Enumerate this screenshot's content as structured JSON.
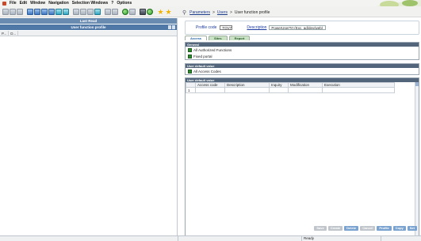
{
  "menu": [
    "File",
    "Edit",
    "Window",
    "Navigation",
    "Selection Windows",
    "?",
    "Options"
  ],
  "breadcrumb": {
    "part1": "Parameters",
    "part2": "Users",
    "current": "User function profile"
  },
  "left_panel": {
    "bar_top": "Last Read",
    "bar_title": "User function profile",
    "columns": [
      "P...",
      "D..."
    ]
  },
  "profile": {
    "code_label": "Profile code",
    "code_value": "TOV7",
    "desc_label": "Description",
    "desc_value": "PowerUserTrt (Exc. ad/dev/web)"
  },
  "tabs": [
    "Access",
    "Sites",
    "Report"
  ],
  "general": {
    "title": "General",
    "options": [
      "All Authorized Functions",
      "Fixed portal"
    ]
  },
  "default_value_1": {
    "title": "User default value",
    "options": [
      "All Access Codes"
    ]
  },
  "default_value_2": {
    "title": "User default value",
    "columns": [
      "Access code",
      "Description",
      "Inquiry",
      "Modification",
      "Execution"
    ],
    "rows": [
      [
        "1",
        "",
        "",
        "",
        "",
        ""
      ]
    ]
  },
  "buttons": [
    "Save",
    "Create",
    "Delete",
    "Cancel",
    "Profile",
    "Copy",
    "Set"
  ],
  "button_states": [
    false,
    false,
    true,
    false,
    true,
    true,
    true
  ],
  "status": {
    "text": "Ready"
  },
  "colors": {
    "accent": "#52657a",
    "tab_active": "#1e5e9e",
    "enabled_button": "#7aa3cf"
  }
}
